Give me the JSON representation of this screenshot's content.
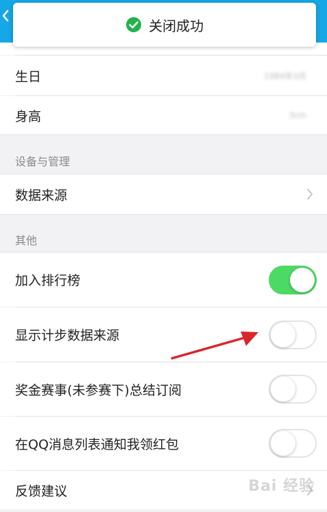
{
  "toast": {
    "text": "关闭成功",
    "icon": "check-circle-icon",
    "icon_color": "#22b14c"
  },
  "header": {
    "color": "#16a7e7",
    "back_icon": "chevron-left-icon"
  },
  "profile": {
    "birthday_label": "生日",
    "birthday_value": "1984年3月",
    "height_label": "身高",
    "height_value": "3cm"
  },
  "sections": {
    "devices_title": "设备与管理",
    "other_title": "其他"
  },
  "devices": {
    "data_source_label": "数据来源"
  },
  "other": {
    "items": [
      {
        "label": "加入排行榜",
        "toggle": "on"
      },
      {
        "label": "显示计步数据来源",
        "toggle": "off"
      },
      {
        "label": "奖金赛事(未参赛下)总结订阅",
        "toggle": "off"
      },
      {
        "label": "在QQ消息列表通知我领红包",
        "toggle": "off"
      }
    ],
    "feedback_label": "反馈建议"
  },
  "colors": {
    "toggle_on": "#4cd964",
    "arrow": "#d9262b"
  },
  "watermark": "Bai 经验"
}
